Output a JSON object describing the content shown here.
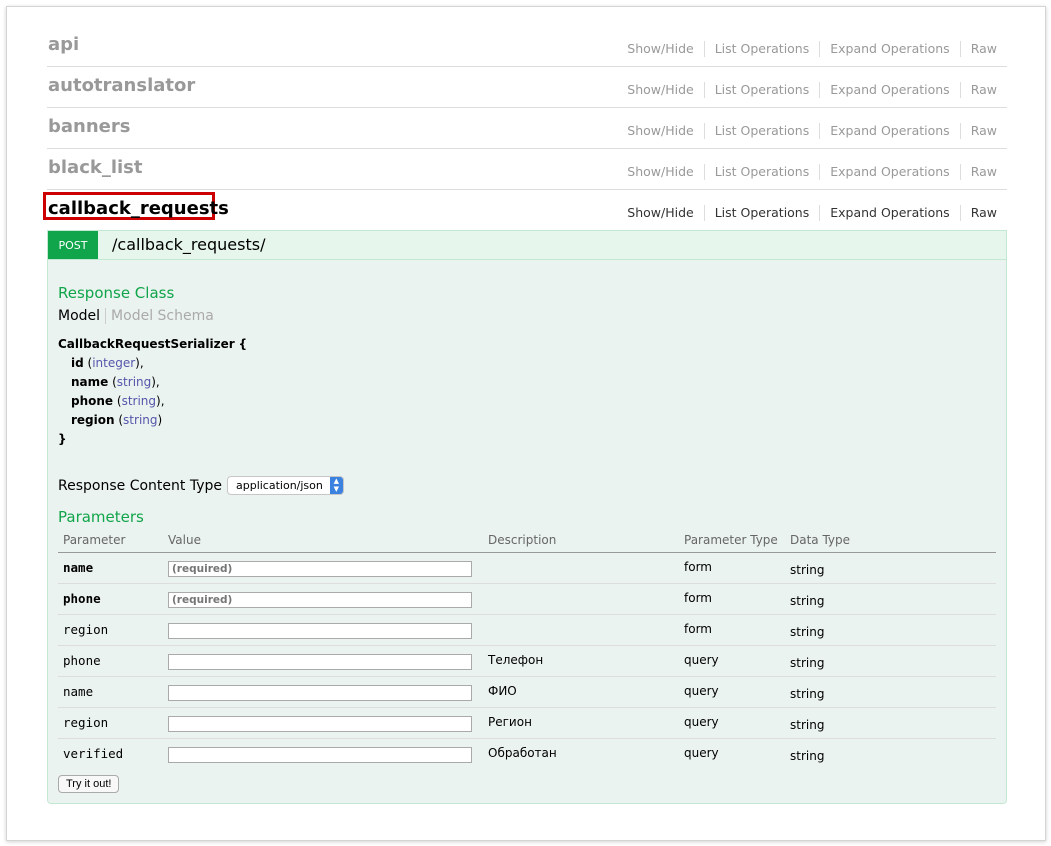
{
  "resources": [
    {
      "name": "api",
      "ops": [
        "Show/Hide",
        "List Operations",
        "Expand Operations",
        "Raw"
      ]
    },
    {
      "name": "autotranslator",
      "ops": [
        "Show/Hide",
        "List Operations",
        "Expand Operations",
        "Raw"
      ]
    },
    {
      "name": "banners",
      "ops": [
        "Show/Hide",
        "List Operations",
        "Expand Operations",
        "Raw"
      ]
    },
    {
      "name": "black_list",
      "ops": [
        "Show/Hide",
        "List Operations",
        "Expand Operations",
        "Raw"
      ]
    },
    {
      "name": "callback_requests",
      "ops": [
        "Show/Hide",
        "List Operations",
        "Expand Operations",
        "Raw"
      ]
    }
  ],
  "operation": {
    "method": "POST",
    "path": "/callback_requests/",
    "response_class_heading": "Response Class",
    "tabs": {
      "model": "Model",
      "schema": "Model Schema"
    },
    "model": {
      "name": "CallbackRequestSerializer",
      "open": "{",
      "close": "}",
      "fields": [
        {
          "name": "id",
          "type": "integer",
          "sep": "),"
        },
        {
          "name": "name",
          "type": "string",
          "sep": "),"
        },
        {
          "name": "phone",
          "type": "string",
          "sep": "),"
        },
        {
          "name": "region",
          "type": "string",
          "sep": ")"
        }
      ]
    },
    "response_content_type_label": "Response Content Type",
    "response_content_type_value": "application/json",
    "parameters_heading": "Parameters",
    "param_headers": [
      "Parameter",
      "Value",
      "Description",
      "Parameter Type",
      "Data Type"
    ],
    "params": [
      {
        "name": "name",
        "placeholder": "(required)",
        "description": "",
        "ptype": "form",
        "dtype": "string",
        "required": true
      },
      {
        "name": "phone",
        "placeholder": "(required)",
        "description": "",
        "ptype": "form",
        "dtype": "string",
        "required": true
      },
      {
        "name": "region",
        "placeholder": "",
        "description": "",
        "ptype": "form",
        "dtype": "string",
        "required": false
      },
      {
        "name": "phone",
        "placeholder": "",
        "description": "Телефон",
        "ptype": "query",
        "dtype": "string",
        "required": false
      },
      {
        "name": "name",
        "placeholder": "",
        "description": "ФИО",
        "ptype": "query",
        "dtype": "string",
        "required": false
      },
      {
        "name": "region",
        "placeholder": "",
        "description": "Регион",
        "ptype": "query",
        "dtype": "string",
        "required": false
      },
      {
        "name": "verified",
        "placeholder": "",
        "description": "Обработан",
        "ptype": "query",
        "dtype": "string",
        "required": false
      }
    ],
    "submit_label": "Try it out!"
  },
  "colors": {
    "post": "#10a54a",
    "highlight": "#cc0000",
    "heading": "#10a54a"
  }
}
